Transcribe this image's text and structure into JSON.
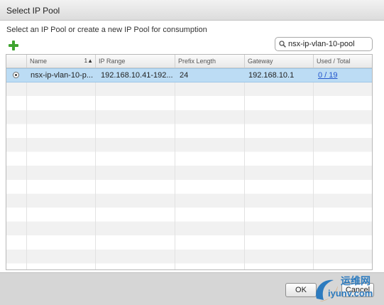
{
  "window": {
    "title": "Select IP Pool"
  },
  "dialog": {
    "instruction": "Select an IP Pool or create a new IP Pool for consumption"
  },
  "toolbar": {
    "add_icon": "green-plus-icon"
  },
  "search": {
    "value": "nsx-ip-vlan-10-pool",
    "icon": "search-icon"
  },
  "table": {
    "sort_indicator": "1▲",
    "columns": [
      "Name",
      "IP Range",
      "Prefix Length",
      "Gateway",
      "Used / Total"
    ],
    "rows": [
      {
        "selected": true,
        "name": "nsx-ip-vlan-10-p...",
        "ip_range": "192.168.10.41-192...",
        "prefix_length": "24",
        "gateway": "192.168.10.1",
        "used_total": "0 / 19"
      }
    ]
  },
  "footer": {
    "ok_label": "OK",
    "cancel_label": "Cancel"
  },
  "watermark": {
    "line1": "运维网",
    "line2": "iyunv.com"
  },
  "colors": {
    "selection": "#bcdcf4",
    "link": "#2255cc",
    "add": "#3fa430",
    "watermark": "#2c7bbf"
  }
}
